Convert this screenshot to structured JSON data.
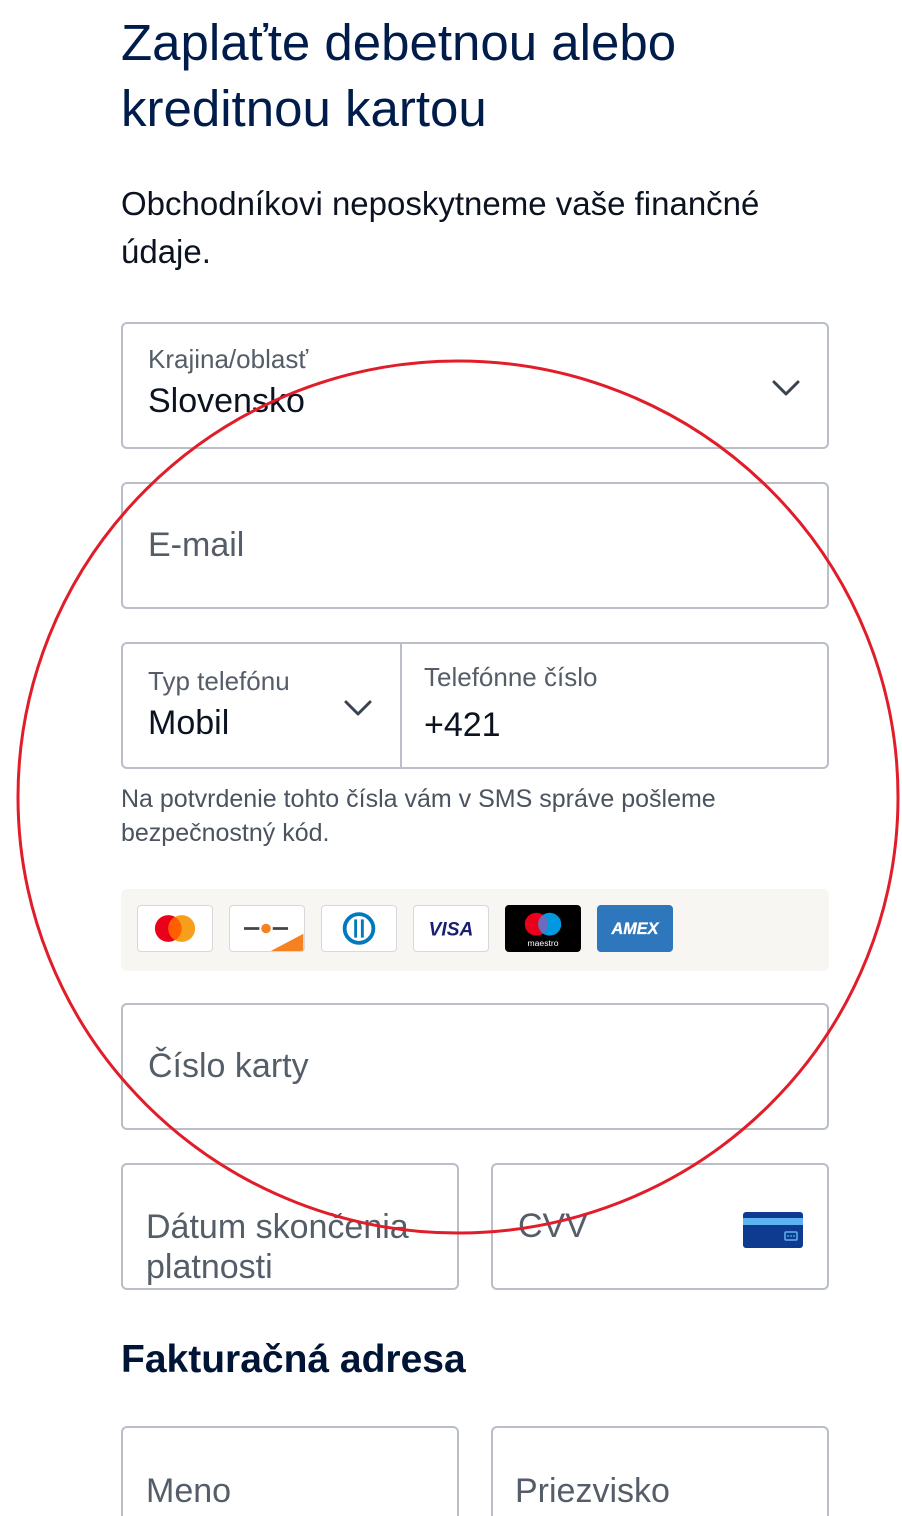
{
  "heading": "Zaplaťte debetnou alebo kreditnou kartou",
  "subheading": "Obchodníkovi neposkytneme vaše finančné údaje.",
  "country": {
    "label": "Krajina/oblasť",
    "value": "Slovensko"
  },
  "email": {
    "placeholder": "E-mail"
  },
  "phone": {
    "type_label": "Typ telefónu",
    "type_value": "Mobil",
    "number_label": "Telefónne číslo",
    "number_value": "+421"
  },
  "phone_helper": "Na potvrdenie tohto čísla vám v SMS správe pošleme bezpečnostný kód.",
  "card_brands": [
    "mastercard",
    "discover",
    "diners-club",
    "visa",
    "maestro",
    "amex"
  ],
  "card_logo_text": {
    "visa": "VISA",
    "maestro": "maestro",
    "amex": "AMEX"
  },
  "card_number": {
    "placeholder": "Číslo karty"
  },
  "expiry": {
    "placeholder": "Dátum skončenia platnosti"
  },
  "cvv": {
    "placeholder": "CVV",
    "icon": "card-back-icon"
  },
  "billing": {
    "title": "Fakturačná adresa",
    "first_name_placeholder": "Meno",
    "last_name_placeholder": "Priezvisko"
  },
  "colors": {
    "heading": "#001c4a",
    "border": "#b9bec7",
    "muted_text": "#545d68",
    "annotation_circle": "#e11d2a"
  }
}
